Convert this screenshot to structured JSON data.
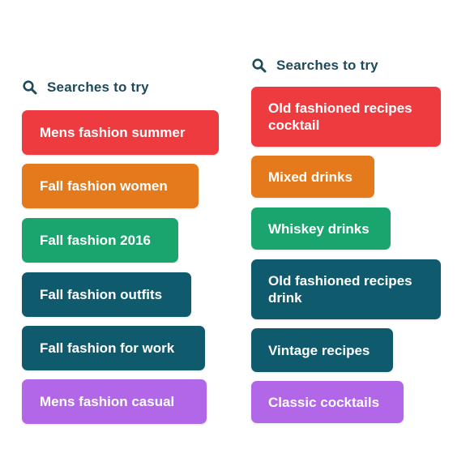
{
  "colors": {
    "red": "#ee3b3f",
    "orange": "#e47a1b",
    "green": "#1aa56f",
    "dark_teal": "#0f5a6d",
    "purple": "#b266e8",
    "heading_text": "#1f4a5a"
  },
  "left_panel": {
    "heading": "Searches to try",
    "heading_icon": "search-icon",
    "items": [
      {
        "label": "Mens fashion summer",
        "color": "#ee3b3f"
      },
      {
        "label": "Fall fashion women",
        "color": "#e47a1b"
      },
      {
        "label": "Fall fashion 2016",
        "color": "#1aa56f"
      },
      {
        "label": "Fall fashion outfits",
        "color": "#0f5a6d"
      },
      {
        "label": "Fall fashion for work",
        "color": "#0f5a6d"
      },
      {
        "label": "Mens fashion casual",
        "color": "#b266e8"
      }
    ]
  },
  "right_panel": {
    "heading": "Searches to try",
    "heading_icon": "search-icon",
    "items": [
      {
        "label": "Old fashioned recipes cocktail",
        "color": "#ee3b3f"
      },
      {
        "label": "Mixed drinks",
        "color": "#e47a1b"
      },
      {
        "label": "Whiskey drinks",
        "color": "#1aa56f"
      },
      {
        "label": "Old fashioned recipes drink",
        "color": "#0f5a6d"
      },
      {
        "label": "Vintage recipes",
        "color": "#0f5a6d"
      },
      {
        "label": "Classic cocktails",
        "color": "#b266e8"
      }
    ]
  }
}
